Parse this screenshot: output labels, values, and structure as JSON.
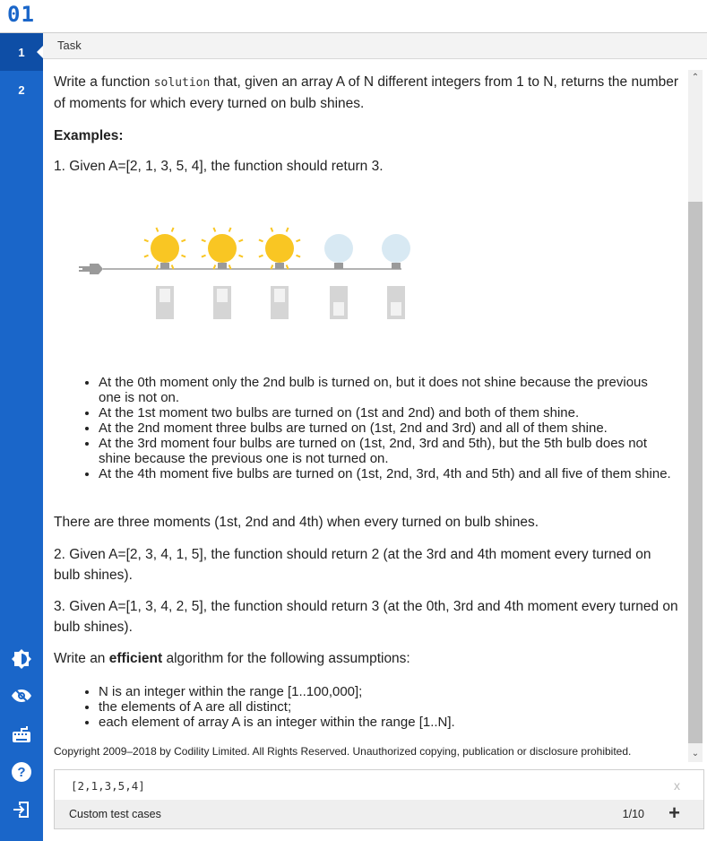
{
  "app": {
    "logo": "01"
  },
  "sidebar": {
    "items": [
      {
        "label": "1"
      },
      {
        "label": "2"
      }
    ],
    "icons": [
      "brightness-icon",
      "eye-icon",
      "keyboard-icon",
      "help-icon",
      "logout-icon"
    ]
  },
  "tab": {
    "label": "Task"
  },
  "task": {
    "intro_before": "Write a function ",
    "intro_code": "solution",
    "intro_after": " that, given an array A of N different integers from 1 to N, returns the number of moments for which every turned on bulb shines.",
    "examples_heading": "Examples:",
    "example1": "1. Given A=[2, 1, 3, 5, 4], the function should return 3.",
    "bullets": [
      "At the 0th moment only the 2nd bulb is turned on, but it does not shine because the previous one is not on.",
      "At the 1st moment two bulbs are turned on (1st and 2nd) and both of them shine.",
      "At the 2nd moment three bulbs are turned on (1st, 2nd and 3rd) and all of them shine.",
      "At the 3rd moment four bulbs are turned on (1st, 2nd, 3rd and 5th), but the 5th bulb does not shine because the previous one is not turned on.",
      "At the 4th moment five bulbs are turned on (1st, 2nd, 3rd, 4th and 5th) and all five of them shine."
    ],
    "summary1": "There are three moments (1st, 2nd and 4th) when every turned on bulb shines.",
    "example2": "2. Given A=[2, 3, 4, 1, 5], the function should return 2 (at the 3rd and 4th moment every turned on bulb shines).",
    "example3": "3. Given A=[1, 3, 4, 2, 5], the function should return 3 (at the 0th, 3rd and 4th moment every turned on bulb shines).",
    "assumptions_before": "Write an ",
    "assumptions_bold": "efficient",
    "assumptions_after": " algorithm for the following assumptions:",
    "assumptions": [
      "N is an integer within the range [1..100,000];",
      "the elements of A are all distinct;",
      "each element of array A is an integer within the range [1..N]."
    ],
    "copyright": "Copyright 2009–2018 by Codility Limited. All Rights Reserved. Unauthorized copying, publication or disclosure prohibited."
  },
  "figure": {
    "bulbs_on": [
      true,
      true,
      true,
      false,
      false
    ],
    "colors": {
      "on": "#f9c623",
      "off": "#d8e9f3",
      "switch": "#d5d5d5",
      "wire": "#9a9a9a"
    }
  },
  "tests": {
    "input_value": "[2,1,3,5,4]",
    "clear_label": "x",
    "custom_label": "Custom test cases",
    "count": "1/10",
    "add_label": "+"
  }
}
